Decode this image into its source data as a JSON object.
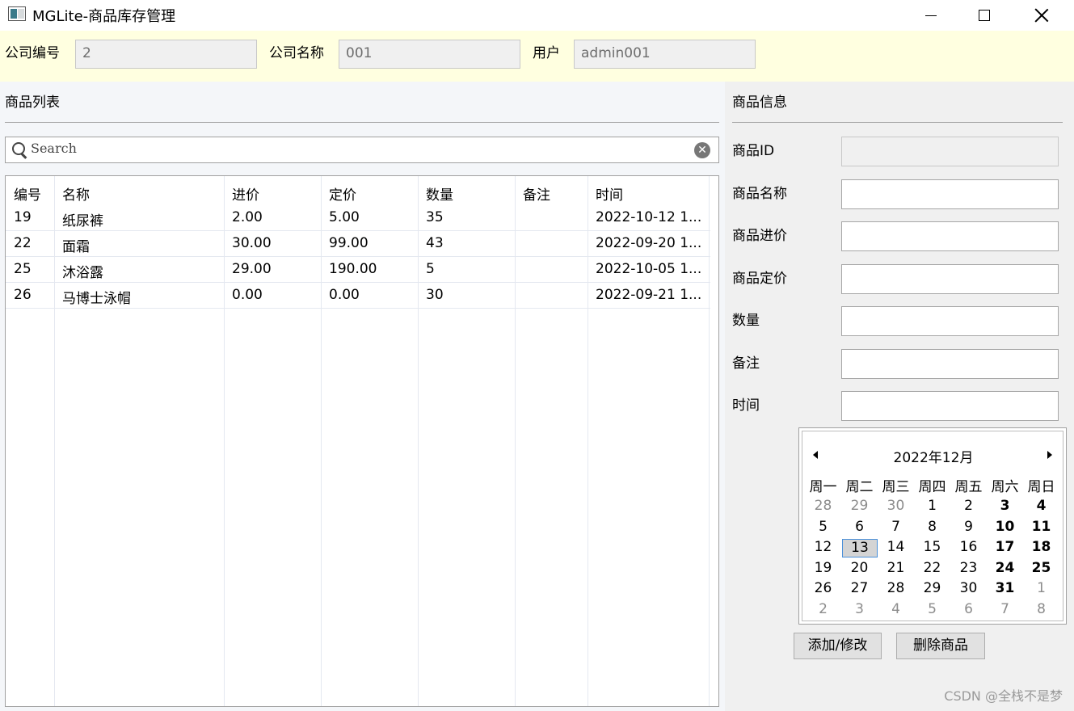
{
  "window": {
    "title": "MGLite-商品库存管理"
  },
  "info": {
    "company_id_label": "公司编号",
    "company_id_value": "2",
    "company_name_label": "公司名称",
    "company_name_value": "001",
    "user_label": "用户",
    "user_value": "admin001"
  },
  "list": {
    "title": "商品列表",
    "search_placeholder": "Search",
    "columns": [
      "编号",
      "名称",
      "进价",
      "定价",
      "数量",
      "备注",
      "时间"
    ],
    "rows": [
      [
        "19",
        "纸尿裤",
        "2.00",
        "5.00",
        "35",
        "",
        "2022-10-12 1..."
      ],
      [
        "22",
        "面霜",
        "30.00",
        "99.00",
        "43",
        "",
        "2022-09-20 1..."
      ],
      [
        "25",
        "沐浴露",
        "29.00",
        "190.00",
        "5",
        "",
        "2022-10-05 1..."
      ],
      [
        "26",
        "马博士泳帽",
        "0.00",
        "0.00",
        "30",
        "",
        "2022-09-21 1..."
      ]
    ]
  },
  "detail": {
    "title": "商品信息",
    "fields": [
      "商品ID",
      "商品名称",
      "商品进价",
      "商品定价",
      "数量",
      "备注",
      "时间"
    ]
  },
  "calendar": {
    "month_label": "2022年12月",
    "weekdays": [
      "周一",
      "周二",
      "周三",
      "周四",
      "周五",
      "周六",
      "周日"
    ],
    "weeks": [
      [
        "28",
        "29",
        "30",
        "1",
        "2",
        "3",
        "4"
      ],
      [
        "5",
        "6",
        "7",
        "8",
        "9",
        "10",
        "11"
      ],
      [
        "12",
        "13",
        "14",
        "15",
        "16",
        "17",
        "18"
      ],
      [
        "19",
        "20",
        "21",
        "22",
        "23",
        "24",
        "25"
      ],
      [
        "26",
        "27",
        "28",
        "29",
        "30",
        "31",
        "1"
      ],
      [
        "2",
        "3",
        "4",
        "5",
        "6",
        "7",
        "8"
      ]
    ],
    "today": "13"
  },
  "buttons": {
    "save": "添加/修改",
    "delete": "删除商品"
  },
  "watermark": "CSDN @全栈不是梦"
}
